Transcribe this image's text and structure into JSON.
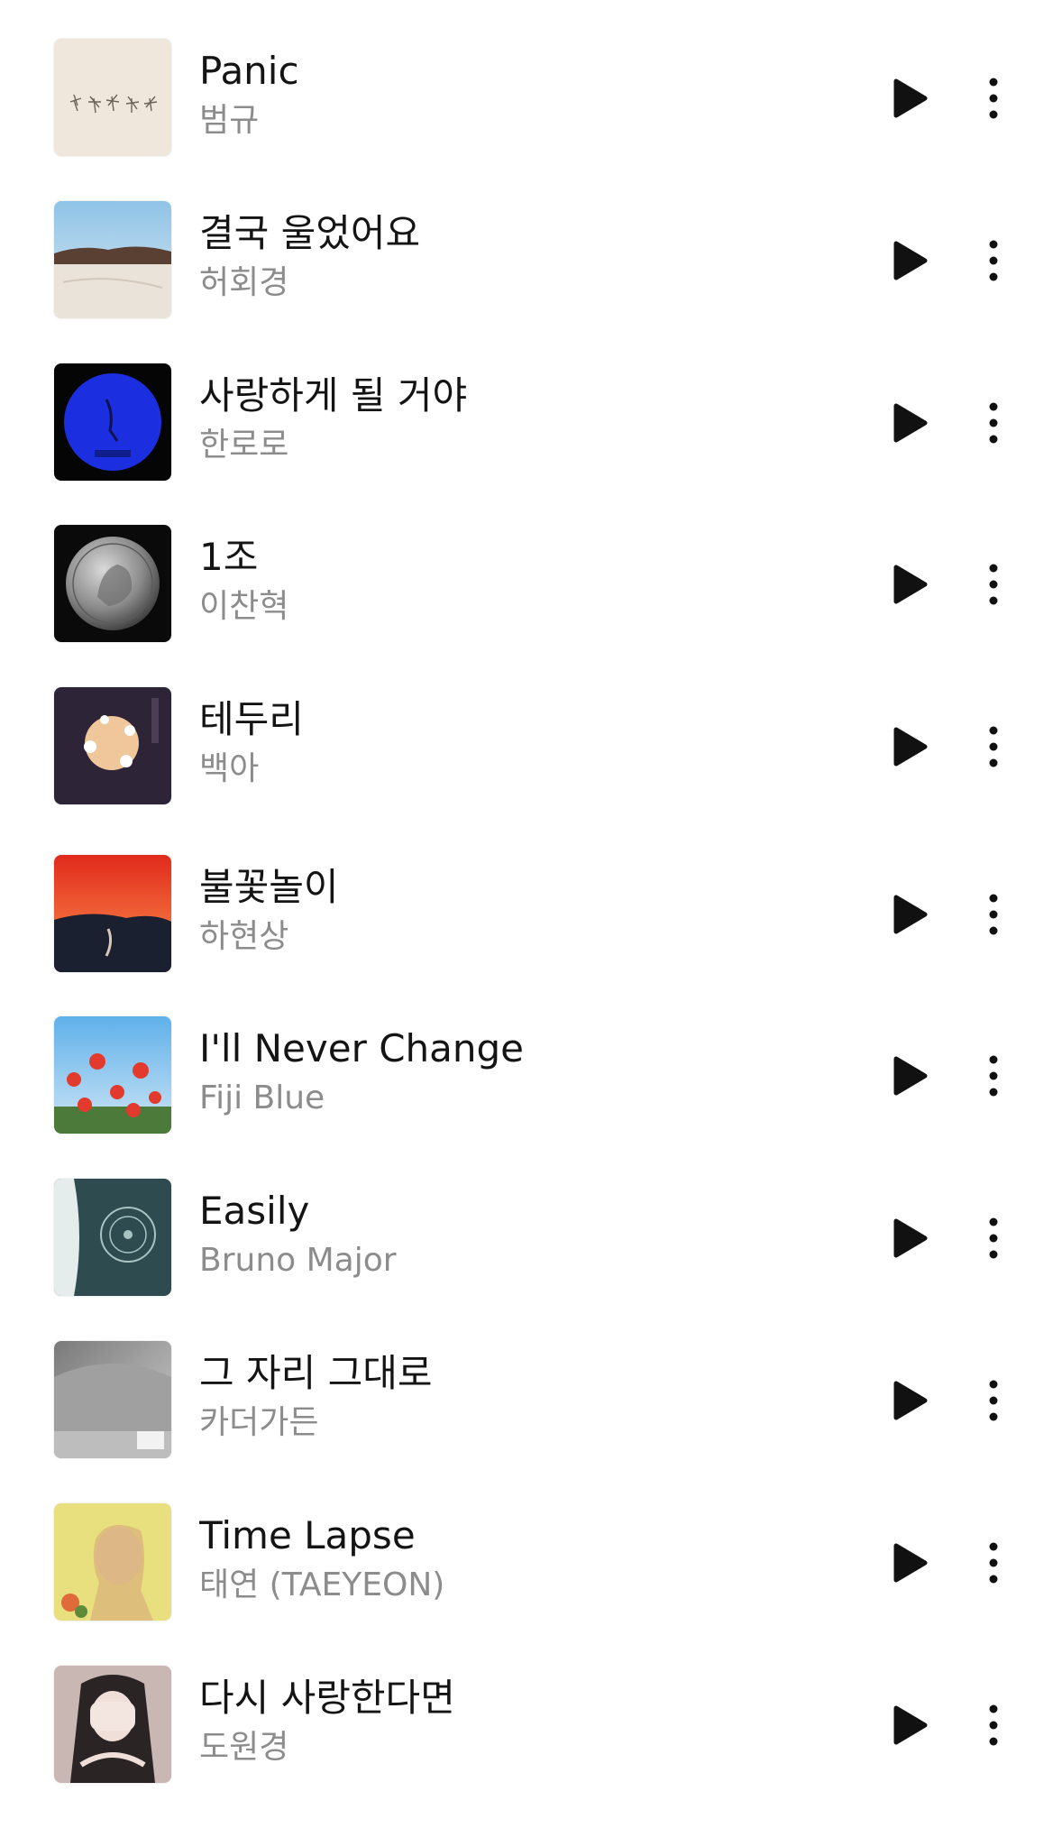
{
  "colors": {
    "background": "#ffffff",
    "title": "#141414",
    "artist": "#8c8c8c",
    "icon": "#111111"
  },
  "icons": {
    "play": "play-icon",
    "more": "more-vertical-icon"
  },
  "tracks": [
    {
      "title": "Panic",
      "artist": "범규",
      "cover": "album-cover-panic"
    },
    {
      "title": "결국 울었어요",
      "artist": "허회경",
      "cover": "album-cover-desert"
    },
    {
      "title": "사랑하게 될 거야",
      "artist": "한로로",
      "cover": "album-cover-blue-circle"
    },
    {
      "title": "1조",
      "artist": "이찬혁",
      "cover": "album-cover-coin"
    },
    {
      "title": "테두리",
      "artist": "백아",
      "cover": "album-cover-moon-flowers"
    },
    {
      "title": "불꽃놀이",
      "artist": "하현상",
      "cover": "album-cover-red-sky"
    },
    {
      "title": "I'll Never Change",
      "artist": "Fiji Blue",
      "cover": "album-cover-poppies"
    },
    {
      "title": "Easily",
      "artist": "Bruno Major",
      "cover": "album-cover-teal-clock"
    },
    {
      "title": "그 자리 그대로",
      "artist": "카더가든",
      "cover": "album-cover-grey-room"
    },
    {
      "title": "Time Lapse",
      "artist": "태연 (TAEYEON)",
      "cover": "album-cover-portrait-yellow"
    },
    {
      "title": "다시 사랑한다면",
      "artist": "도원경",
      "cover": "album-cover-portrait-hands"
    }
  ]
}
